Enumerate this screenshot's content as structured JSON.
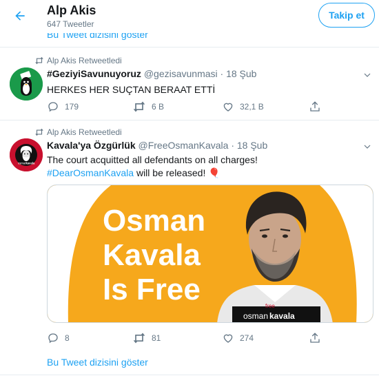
{
  "header": {
    "title": "Alp Akis",
    "tweet_count": "647 Tweetler",
    "follow_label": "Takip et",
    "show_thread_label": "Bu Tweet dizisini göster"
  },
  "tweets": [
    {
      "retweet_label": "Alp Akis Retweetledi",
      "name": "#GeziyiSavunuyoruz",
      "handle": "@gezisavunmasi",
      "date": "· 18 Şub",
      "text": "HERKES HER SUÇTAN BERAAT ETTİ",
      "replies": "179",
      "retweets": "6 B",
      "likes": "32,1 B"
    },
    {
      "retweet_label": "Alp Akis Retweetledi",
      "name": "Kavala'ya Özgürlük",
      "handle": "@FreeOsmanKavala",
      "date": "· 18 Şub",
      "text_line1": "The court acquitted all defendants on all charges!",
      "hashtag": "#DearOsmanKavala",
      "text_line2_rest": " will be released! 🎈",
      "media": {
        "line1": "Osman",
        "line2": "Kavala",
        "line3": "Is Free",
        "logo_small": "free",
        "logo_osman": "osman",
        "logo_kavala": "kavala",
        "avatar_text_osman": "osman",
        "avatar_text_kavala": "kavala"
      },
      "replies": "8",
      "retweets": "81",
      "likes": "274",
      "show_thread_label": "Bu Tweet dizisini göster"
    }
  ],
  "colors": {
    "accent": "#1da1f2",
    "muted": "#657786",
    "media_orange": "#f6a81c",
    "gezi_green": "#1a9a4a"
  }
}
